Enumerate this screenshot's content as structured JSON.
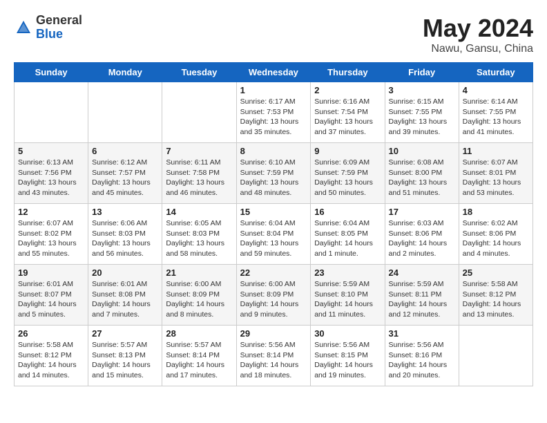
{
  "header": {
    "logo_general": "General",
    "logo_blue": "Blue",
    "month_title": "May 2024",
    "subtitle": "Nawu, Gansu, China"
  },
  "weekdays": [
    "Sunday",
    "Monday",
    "Tuesday",
    "Wednesday",
    "Thursday",
    "Friday",
    "Saturday"
  ],
  "weeks": [
    [
      {
        "day": "",
        "info": ""
      },
      {
        "day": "",
        "info": ""
      },
      {
        "day": "",
        "info": ""
      },
      {
        "day": "1",
        "info": "Sunrise: 6:17 AM\nSunset: 7:53 PM\nDaylight: 13 hours\nand 35 minutes."
      },
      {
        "day": "2",
        "info": "Sunrise: 6:16 AM\nSunset: 7:54 PM\nDaylight: 13 hours\nand 37 minutes."
      },
      {
        "day": "3",
        "info": "Sunrise: 6:15 AM\nSunset: 7:55 PM\nDaylight: 13 hours\nand 39 minutes."
      },
      {
        "day": "4",
        "info": "Sunrise: 6:14 AM\nSunset: 7:55 PM\nDaylight: 13 hours\nand 41 minutes."
      }
    ],
    [
      {
        "day": "5",
        "info": "Sunrise: 6:13 AM\nSunset: 7:56 PM\nDaylight: 13 hours\nand 43 minutes."
      },
      {
        "day": "6",
        "info": "Sunrise: 6:12 AM\nSunset: 7:57 PM\nDaylight: 13 hours\nand 45 minutes."
      },
      {
        "day": "7",
        "info": "Sunrise: 6:11 AM\nSunset: 7:58 PM\nDaylight: 13 hours\nand 46 minutes."
      },
      {
        "day": "8",
        "info": "Sunrise: 6:10 AM\nSunset: 7:59 PM\nDaylight: 13 hours\nand 48 minutes."
      },
      {
        "day": "9",
        "info": "Sunrise: 6:09 AM\nSunset: 7:59 PM\nDaylight: 13 hours\nand 50 minutes."
      },
      {
        "day": "10",
        "info": "Sunrise: 6:08 AM\nSunset: 8:00 PM\nDaylight: 13 hours\nand 51 minutes."
      },
      {
        "day": "11",
        "info": "Sunrise: 6:07 AM\nSunset: 8:01 PM\nDaylight: 13 hours\nand 53 minutes."
      }
    ],
    [
      {
        "day": "12",
        "info": "Sunrise: 6:07 AM\nSunset: 8:02 PM\nDaylight: 13 hours\nand 55 minutes."
      },
      {
        "day": "13",
        "info": "Sunrise: 6:06 AM\nSunset: 8:03 PM\nDaylight: 13 hours\nand 56 minutes."
      },
      {
        "day": "14",
        "info": "Sunrise: 6:05 AM\nSunset: 8:03 PM\nDaylight: 13 hours\nand 58 minutes."
      },
      {
        "day": "15",
        "info": "Sunrise: 6:04 AM\nSunset: 8:04 PM\nDaylight: 13 hours\nand 59 minutes."
      },
      {
        "day": "16",
        "info": "Sunrise: 6:04 AM\nSunset: 8:05 PM\nDaylight: 14 hours\nand 1 minute."
      },
      {
        "day": "17",
        "info": "Sunrise: 6:03 AM\nSunset: 8:06 PM\nDaylight: 14 hours\nand 2 minutes."
      },
      {
        "day": "18",
        "info": "Sunrise: 6:02 AM\nSunset: 8:06 PM\nDaylight: 14 hours\nand 4 minutes."
      }
    ],
    [
      {
        "day": "19",
        "info": "Sunrise: 6:01 AM\nSunset: 8:07 PM\nDaylight: 14 hours\nand 5 minutes."
      },
      {
        "day": "20",
        "info": "Sunrise: 6:01 AM\nSunset: 8:08 PM\nDaylight: 14 hours\nand 7 minutes."
      },
      {
        "day": "21",
        "info": "Sunrise: 6:00 AM\nSunset: 8:09 PM\nDaylight: 14 hours\nand 8 minutes."
      },
      {
        "day": "22",
        "info": "Sunrise: 6:00 AM\nSunset: 8:09 PM\nDaylight: 14 hours\nand 9 minutes."
      },
      {
        "day": "23",
        "info": "Sunrise: 5:59 AM\nSunset: 8:10 PM\nDaylight: 14 hours\nand 11 minutes."
      },
      {
        "day": "24",
        "info": "Sunrise: 5:59 AM\nSunset: 8:11 PM\nDaylight: 14 hours\nand 12 minutes."
      },
      {
        "day": "25",
        "info": "Sunrise: 5:58 AM\nSunset: 8:12 PM\nDaylight: 14 hours\nand 13 minutes."
      }
    ],
    [
      {
        "day": "26",
        "info": "Sunrise: 5:58 AM\nSunset: 8:12 PM\nDaylight: 14 hours\nand 14 minutes."
      },
      {
        "day": "27",
        "info": "Sunrise: 5:57 AM\nSunset: 8:13 PM\nDaylight: 14 hours\nand 15 minutes."
      },
      {
        "day": "28",
        "info": "Sunrise: 5:57 AM\nSunset: 8:14 PM\nDaylight: 14 hours\nand 17 minutes."
      },
      {
        "day": "29",
        "info": "Sunrise: 5:56 AM\nSunset: 8:14 PM\nDaylight: 14 hours\nand 18 minutes."
      },
      {
        "day": "30",
        "info": "Sunrise: 5:56 AM\nSunset: 8:15 PM\nDaylight: 14 hours\nand 19 minutes."
      },
      {
        "day": "31",
        "info": "Sunrise: 5:56 AM\nSunset: 8:16 PM\nDaylight: 14 hours\nand 20 minutes."
      },
      {
        "day": "",
        "info": ""
      }
    ]
  ]
}
